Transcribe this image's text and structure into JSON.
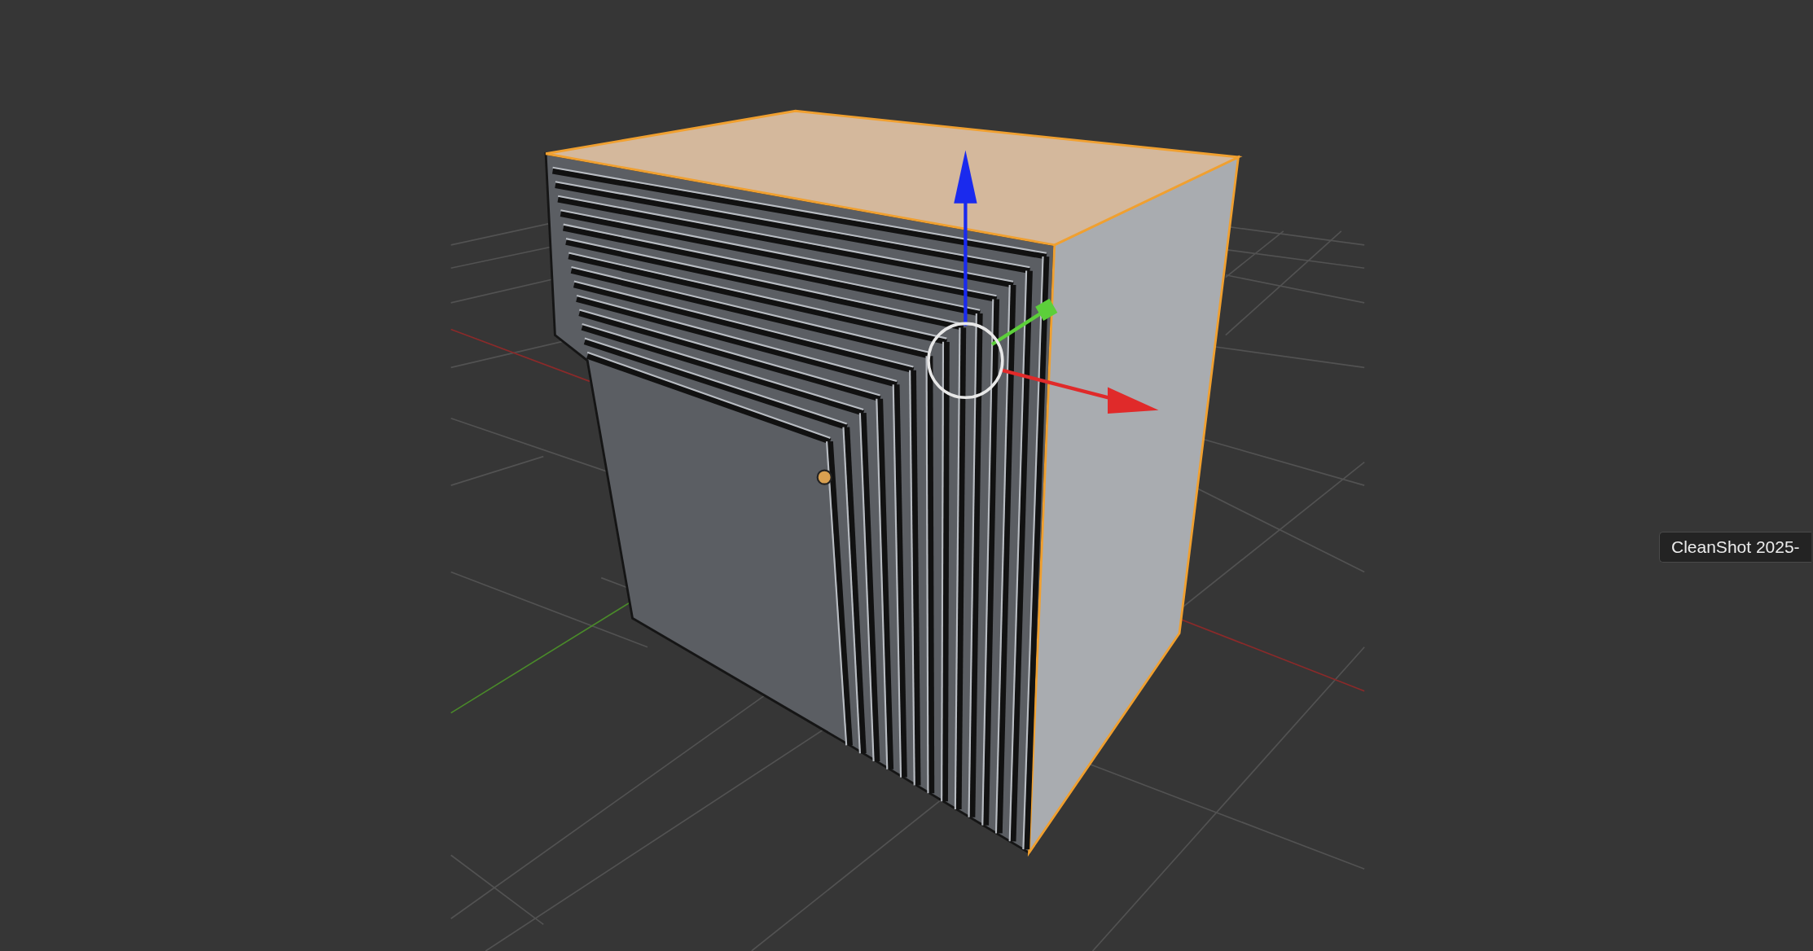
{
  "tooltip": {
    "text": "CleanShot 2025-"
  }
}
